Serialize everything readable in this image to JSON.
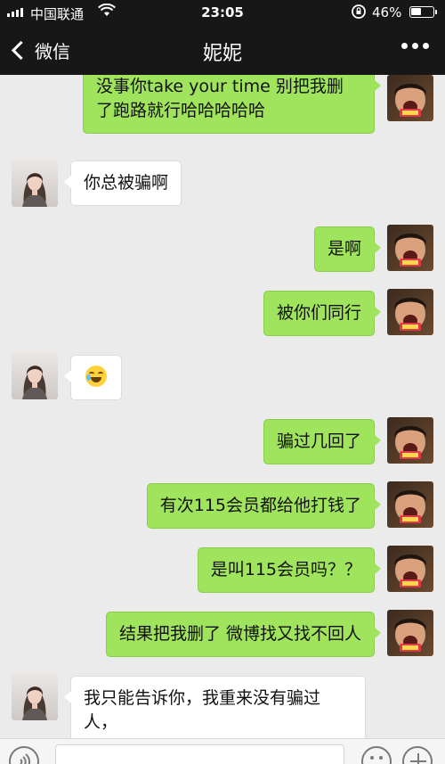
{
  "status_bar": {
    "carrier": "中国联通",
    "time": "23:05",
    "battery": "46%",
    "battery_level": 0.46,
    "icons": [
      "signal-icon",
      "wifi-icon",
      "rotation-lock-icon",
      "battery-icon"
    ]
  },
  "nav": {
    "back_label": "微信",
    "title": "妮妮",
    "more_icon": "more-icon"
  },
  "messages": [
    {
      "side": "out",
      "lines": [
        "没事你take your time  别把我删",
        "了跑路就行哈哈哈哈哈"
      ]
    },
    {
      "side": "in",
      "lines": [
        "你总被骗啊"
      ]
    },
    {
      "side": "out",
      "lines": [
        "是啊"
      ]
    },
    {
      "side": "out",
      "lines": [
        "被你们同行"
      ]
    },
    {
      "side": "in",
      "lines": [],
      "emoji": "laughing-crying-emoji"
    },
    {
      "side": "out",
      "lines": [
        "骗过几回了"
      ]
    },
    {
      "side": "out",
      "lines": [
        "有次115会员都给他打钱了"
      ]
    },
    {
      "side": "out",
      "lines": [
        "是叫115会员吗？？"
      ]
    },
    {
      "side": "out",
      "lines": [
        "结果把我删了  微博找又找不回人"
      ]
    },
    {
      "side": "in",
      "lines": [
        "我只能告诉你，我重来没有骗过",
        "人，"
      ]
    }
  ],
  "input_bar": {
    "icons": [
      "voice-icon",
      "emoji-icon",
      "plus-icon"
    ]
  },
  "colors": {
    "header_bg": "#171717",
    "chat_bg": "#ebebeb",
    "out_bubble": "#9fe45c",
    "in_bubble": "#ffffff"
  }
}
